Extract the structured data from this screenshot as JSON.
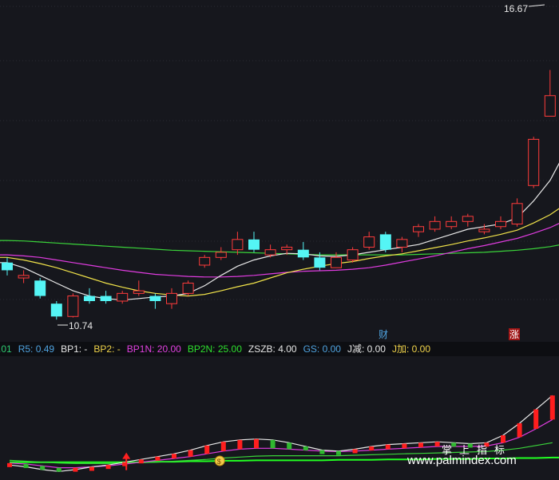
{
  "chart_data": {
    "type": "candlestick",
    "high_label": "16.67",
    "low_label": "10.74",
    "markers": {
      "cai": "财",
      "zhang": "涨"
    },
    "candles": [
      {
        "o": 11.85,
        "c": 11.7,
        "h": 11.95,
        "l": 11.6
      },
      {
        "o": 11.55,
        "c": 11.6,
        "h": 11.7,
        "l": 11.45
      },
      {
        "o": 11.5,
        "c": 11.2,
        "h": 11.55,
        "l": 11.15
      },
      {
        "o": 11.05,
        "c": 10.8,
        "h": 11.1,
        "l": 10.74
      },
      {
        "o": 10.8,
        "c": 11.2,
        "h": 11.25,
        "l": 10.78
      },
      {
        "o": 11.2,
        "c": 11.1,
        "h": 11.35,
        "l": 11.05
      },
      {
        "o": 11.2,
        "c": 11.1,
        "h": 11.3,
        "l": 11.05
      },
      {
        "o": 11.1,
        "c": 11.25,
        "h": 11.3,
        "l": 11.05
      },
      {
        "o": 11.25,
        "c": 11.3,
        "h": 11.5,
        "l": 11.2
      },
      {
        "o": 11.2,
        "c": 11.1,
        "h": 11.25,
        "l": 10.95
      },
      {
        "o": 11.05,
        "c": 11.25,
        "h": 11.35,
        "l": 10.95
      },
      {
        "o": 11.25,
        "c": 11.45,
        "h": 11.5,
        "l": 11.2
      },
      {
        "o": 11.8,
        "c": 11.95,
        "h": 12.0,
        "l": 11.75
      },
      {
        "o": 11.95,
        "c": 12.05,
        "h": 12.15,
        "l": 11.9
      },
      {
        "o": 12.1,
        "c": 12.3,
        "h": 12.45,
        "l": 12.0
      },
      {
        "o": 12.3,
        "c": 12.1,
        "h": 12.45,
        "l": 12.05
      },
      {
        "o": 12.0,
        "c": 12.1,
        "h": 12.2,
        "l": 11.95
      },
      {
        "o": 12.1,
        "c": 12.15,
        "h": 12.2,
        "l": 12.0
      },
      {
        "o": 12.1,
        "c": 11.95,
        "h": 12.25,
        "l": 11.9
      },
      {
        "o": 11.95,
        "c": 11.75,
        "h": 12.05,
        "l": 11.7
      },
      {
        "o": 11.75,
        "c": 11.95,
        "h": 12.05,
        "l": 11.75
      },
      {
        "o": 11.9,
        "c": 12.1,
        "h": 12.15,
        "l": 11.85
      },
      {
        "o": 12.15,
        "c": 12.35,
        "h": 12.45,
        "l": 12.1
      },
      {
        "o": 12.4,
        "c": 12.1,
        "h": 12.45,
        "l": 12.05
      },
      {
        "o": 12.15,
        "c": 12.3,
        "h": 12.35,
        "l": 12.05
      },
      {
        "o": 12.45,
        "c": 12.55,
        "h": 12.6,
        "l": 12.35
      },
      {
        "o": 12.5,
        "c": 12.65,
        "h": 12.75,
        "l": 12.45
      },
      {
        "o": 12.55,
        "c": 12.65,
        "h": 12.75,
        "l": 12.5
      },
      {
        "o": 12.65,
        "c": 12.75,
        "h": 12.8,
        "l": 12.55
      },
      {
        "o": 12.45,
        "c": 12.5,
        "h": 12.6,
        "l": 12.4
      },
      {
        "o": 12.55,
        "c": 12.65,
        "h": 12.75,
        "l": 12.5
      },
      {
        "o": 12.6,
        "c": 13.0,
        "h": 13.1,
        "l": 12.55
      },
      {
        "o": 13.35,
        "c": 14.25,
        "h": 14.3,
        "l": 13.3
      },
      {
        "o": 14.7,
        "c": 15.1,
        "h": 15.6,
        "l": 14.7
      },
      {
        "o": 15.2,
        "c": 16.15,
        "h": 16.67,
        "l": 14.9
      }
    ],
    "ma_white": [
      11.85,
      11.75,
      11.6,
      11.45,
      11.3,
      11.2,
      11.15,
      11.12,
      11.15,
      11.18,
      11.2,
      11.25,
      11.4,
      11.6,
      11.78,
      11.9,
      11.98,
      12.03,
      12.02,
      11.98,
      11.97,
      12.0,
      12.05,
      12.1,
      12.15,
      12.2,
      12.3,
      12.4,
      12.5,
      12.55,
      12.6,
      12.72,
      13.05,
      13.45,
      14.05
    ],
    "ma_yellow": [
      11.95,
      11.9,
      11.83,
      11.75,
      11.65,
      11.55,
      11.45,
      11.37,
      11.3,
      11.25,
      11.22,
      11.2,
      11.23,
      11.3,
      11.38,
      11.45,
      11.55,
      11.65,
      11.72,
      11.78,
      11.83,
      11.87,
      11.93,
      11.98,
      12.02,
      12.08,
      12.14,
      12.2,
      12.27,
      12.33,
      12.4,
      12.48,
      12.62,
      12.78,
      13.0
    ],
    "ma_magenta": [
      12.0,
      11.98,
      11.95,
      11.9,
      11.85,
      11.8,
      11.75,
      11.7,
      11.66,
      11.62,
      11.6,
      11.58,
      11.57,
      11.57,
      11.58,
      11.6,
      11.63,
      11.66,
      11.68,
      11.69,
      11.7,
      11.72,
      11.75,
      11.8,
      11.86,
      11.92,
      11.98,
      12.05,
      12.12,
      12.18,
      12.25,
      12.32,
      12.42,
      12.53,
      12.68
    ],
    "ma_green": [
      12.28,
      12.27,
      12.25,
      12.23,
      12.21,
      12.19,
      12.17,
      12.15,
      12.13,
      12.11,
      12.09,
      12.08,
      12.07,
      12.06,
      12.05,
      12.04,
      12.03,
      12.02,
      12.01,
      12.0,
      12.0,
      12.0,
      12.0,
      12.0,
      12.0,
      12.01,
      12.02,
      12.03,
      12.04,
      12.05,
      12.07,
      12.09,
      12.12,
      12.16,
      12.22
    ],
    "sub": {
      "bars": [
        -8,
        -14,
        -22,
        -28,
        -18,
        -10,
        -6,
        6,
        10,
        14,
        18,
        24,
        30,
        36,
        40,
        44,
        36,
        30,
        22,
        12,
        8,
        16,
        24,
        28,
        30,
        32,
        34,
        30,
        24,
        30,
        56,
        92,
        122,
        150
      ],
      "line_white": [
        -2,
        -6,
        -12,
        -16,
        -12,
        -6,
        -2,
        4,
        10,
        16,
        22,
        30,
        40,
        48,
        52,
        54,
        52,
        46,
        38,
        30,
        28,
        32,
        38,
        42,
        44,
        46,
        48,
        46,
        44,
        46,
        62,
        88,
        118,
        148
      ],
      "line_magenta": [
        2,
        0,
        -4,
        -8,
        -8,
        -6,
        -4,
        0,
        4,
        8,
        12,
        16,
        22,
        28,
        32,
        34,
        34,
        32,
        30,
        28,
        27,
        28,
        30,
        32,
        34,
        36,
        38,
        38,
        38,
        39,
        46,
        58,
        76,
        96
      ],
      "line_green": [
        8,
        6,
        4,
        2,
        1,
        1,
        1,
        2,
        3,
        4,
        6,
        8,
        10,
        13,
        15,
        17,
        18,
        18,
        18,
        18,
        18,
        19,
        20,
        21,
        22,
        23,
        24,
        25,
        26,
        27,
        30,
        34,
        40,
        46
      ],
      "line_brightgreen": [
        4,
        4,
        4,
        4,
        4,
        4,
        4,
        4,
        4,
        5,
        5,
        6,
        6,
        7,
        7,
        8,
        8,
        8,
        8,
        8,
        9,
        9,
        9,
        10,
        10,
        10,
        11,
        11,
        11,
        12,
        12,
        13,
        13,
        14
      ],
      "arrow_index": 7,
      "coin_index": 12
    }
  },
  "indicators": [
    {
      "label": ".01",
      "color": "#2ecc71"
    },
    {
      "label": "R5: 0.49",
      "color": "#4fa3e0"
    },
    {
      "label": "BP1: -",
      "color": "#e6e6e6"
    },
    {
      "label": "BP2: -",
      "color": "#f1d44a"
    },
    {
      "label": "BP1N: 20.00",
      "color": "#e040e0"
    },
    {
      "label": "BP2N: 25.00",
      "color": "#2ee02e"
    },
    {
      "label": "ZSZB: 4.00",
      "color": "#e6e6e6"
    },
    {
      "label": "GS: 0.00",
      "color": "#4fa3e0"
    },
    {
      "label": "J减: 0.00",
      "color": "#e6e6e6"
    },
    {
      "label": "J加: 0.00",
      "color": "#f1d44a"
    }
  ],
  "watermark": {
    "cn": "掌上指标",
    "url": "www.palmindex.com"
  },
  "colors": {
    "up": "#ff3b3b",
    "down": "#54f5f5",
    "white": "#e8e8e8",
    "yellow": "#f1e34a",
    "magenta": "#e03ce0",
    "green": "#3ad43a",
    "bright_green": "#22ff22",
    "bg": "#16171d",
    "grid": "#2a2b33"
  }
}
